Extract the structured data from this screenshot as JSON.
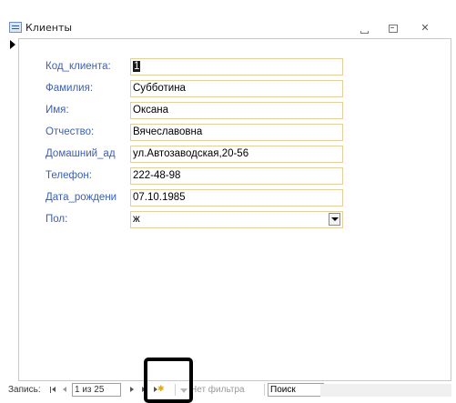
{
  "window": {
    "title": "Клиенты",
    "icons": {
      "form": "form-icon",
      "minimize": "minimize-icon",
      "maximize": "maximize-icon",
      "close": "close-icon"
    }
  },
  "fields": [
    {
      "label": "Код_клиента:",
      "value": "1"
    },
    {
      "label": "Фамилия:",
      "value": "Субботина"
    },
    {
      "label": "Имя:",
      "value": "Оксана"
    },
    {
      "label": "Отчество:",
      "value": "Вячеславовна"
    },
    {
      "label": "Домашний_ад",
      "value": "ул.Автозаводская,20-56"
    },
    {
      "label": "Телефон:",
      "value": "222-48-98"
    },
    {
      "label": "Дата_рождени",
      "value": "07.10.1985"
    },
    {
      "label": "Пол:",
      "value": "ж"
    }
  ],
  "navigation": {
    "label": "Запись:",
    "current": "1 из 25",
    "filter": "Нет фильтра",
    "search": "Поиск"
  },
  "colors": {
    "label_text": "#3b5fb5",
    "field_border": "#e3cf9c",
    "highlight": "#000000"
  }
}
